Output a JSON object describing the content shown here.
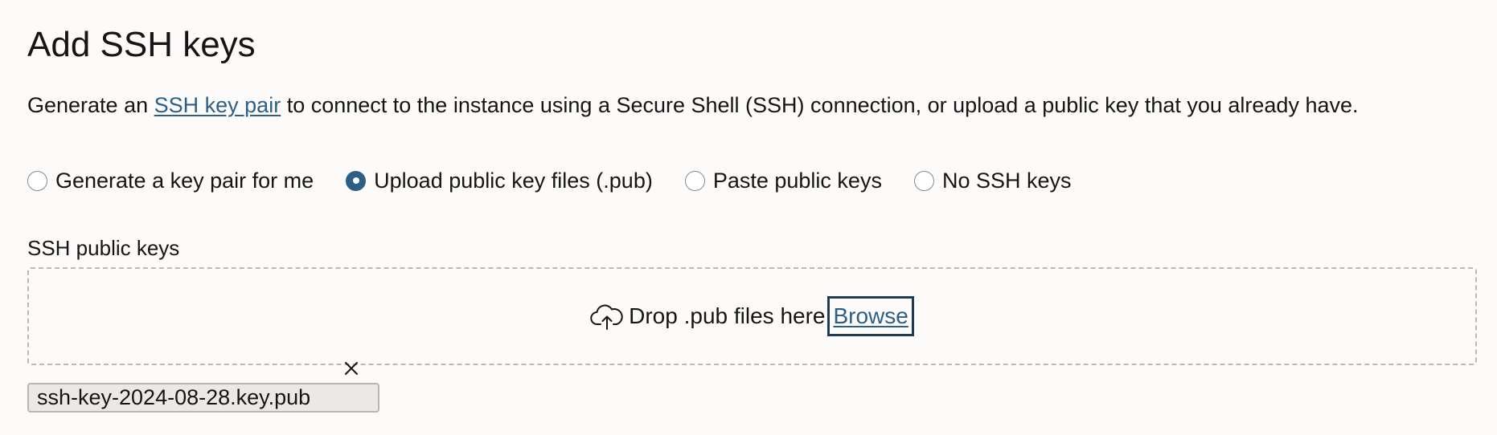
{
  "section": {
    "title": "Add SSH keys",
    "description_before": "Generate an ",
    "description_link": "SSH key pair",
    "description_after": " to connect to the instance using a Secure Shell (SSH) connection, or upload a public key that you already have."
  },
  "options": [
    {
      "label": "Generate a key pair for me",
      "selected": false
    },
    {
      "label": "Upload public key files (.pub)",
      "selected": true
    },
    {
      "label": "Paste public keys",
      "selected": false
    },
    {
      "label": "No SSH keys",
      "selected": false
    }
  ],
  "upload": {
    "field_label": "SSH public keys",
    "drop_text": "Drop .pub files here",
    "browse_label": "Browse",
    "icon": "cloud-upload-icon"
  },
  "files": [
    {
      "name": "ssh-key-2024-08-28.key.pub"
    }
  ],
  "colors": {
    "accent": "#2c5f85",
    "text": "#161513",
    "background": "#fcfbfa"
  }
}
